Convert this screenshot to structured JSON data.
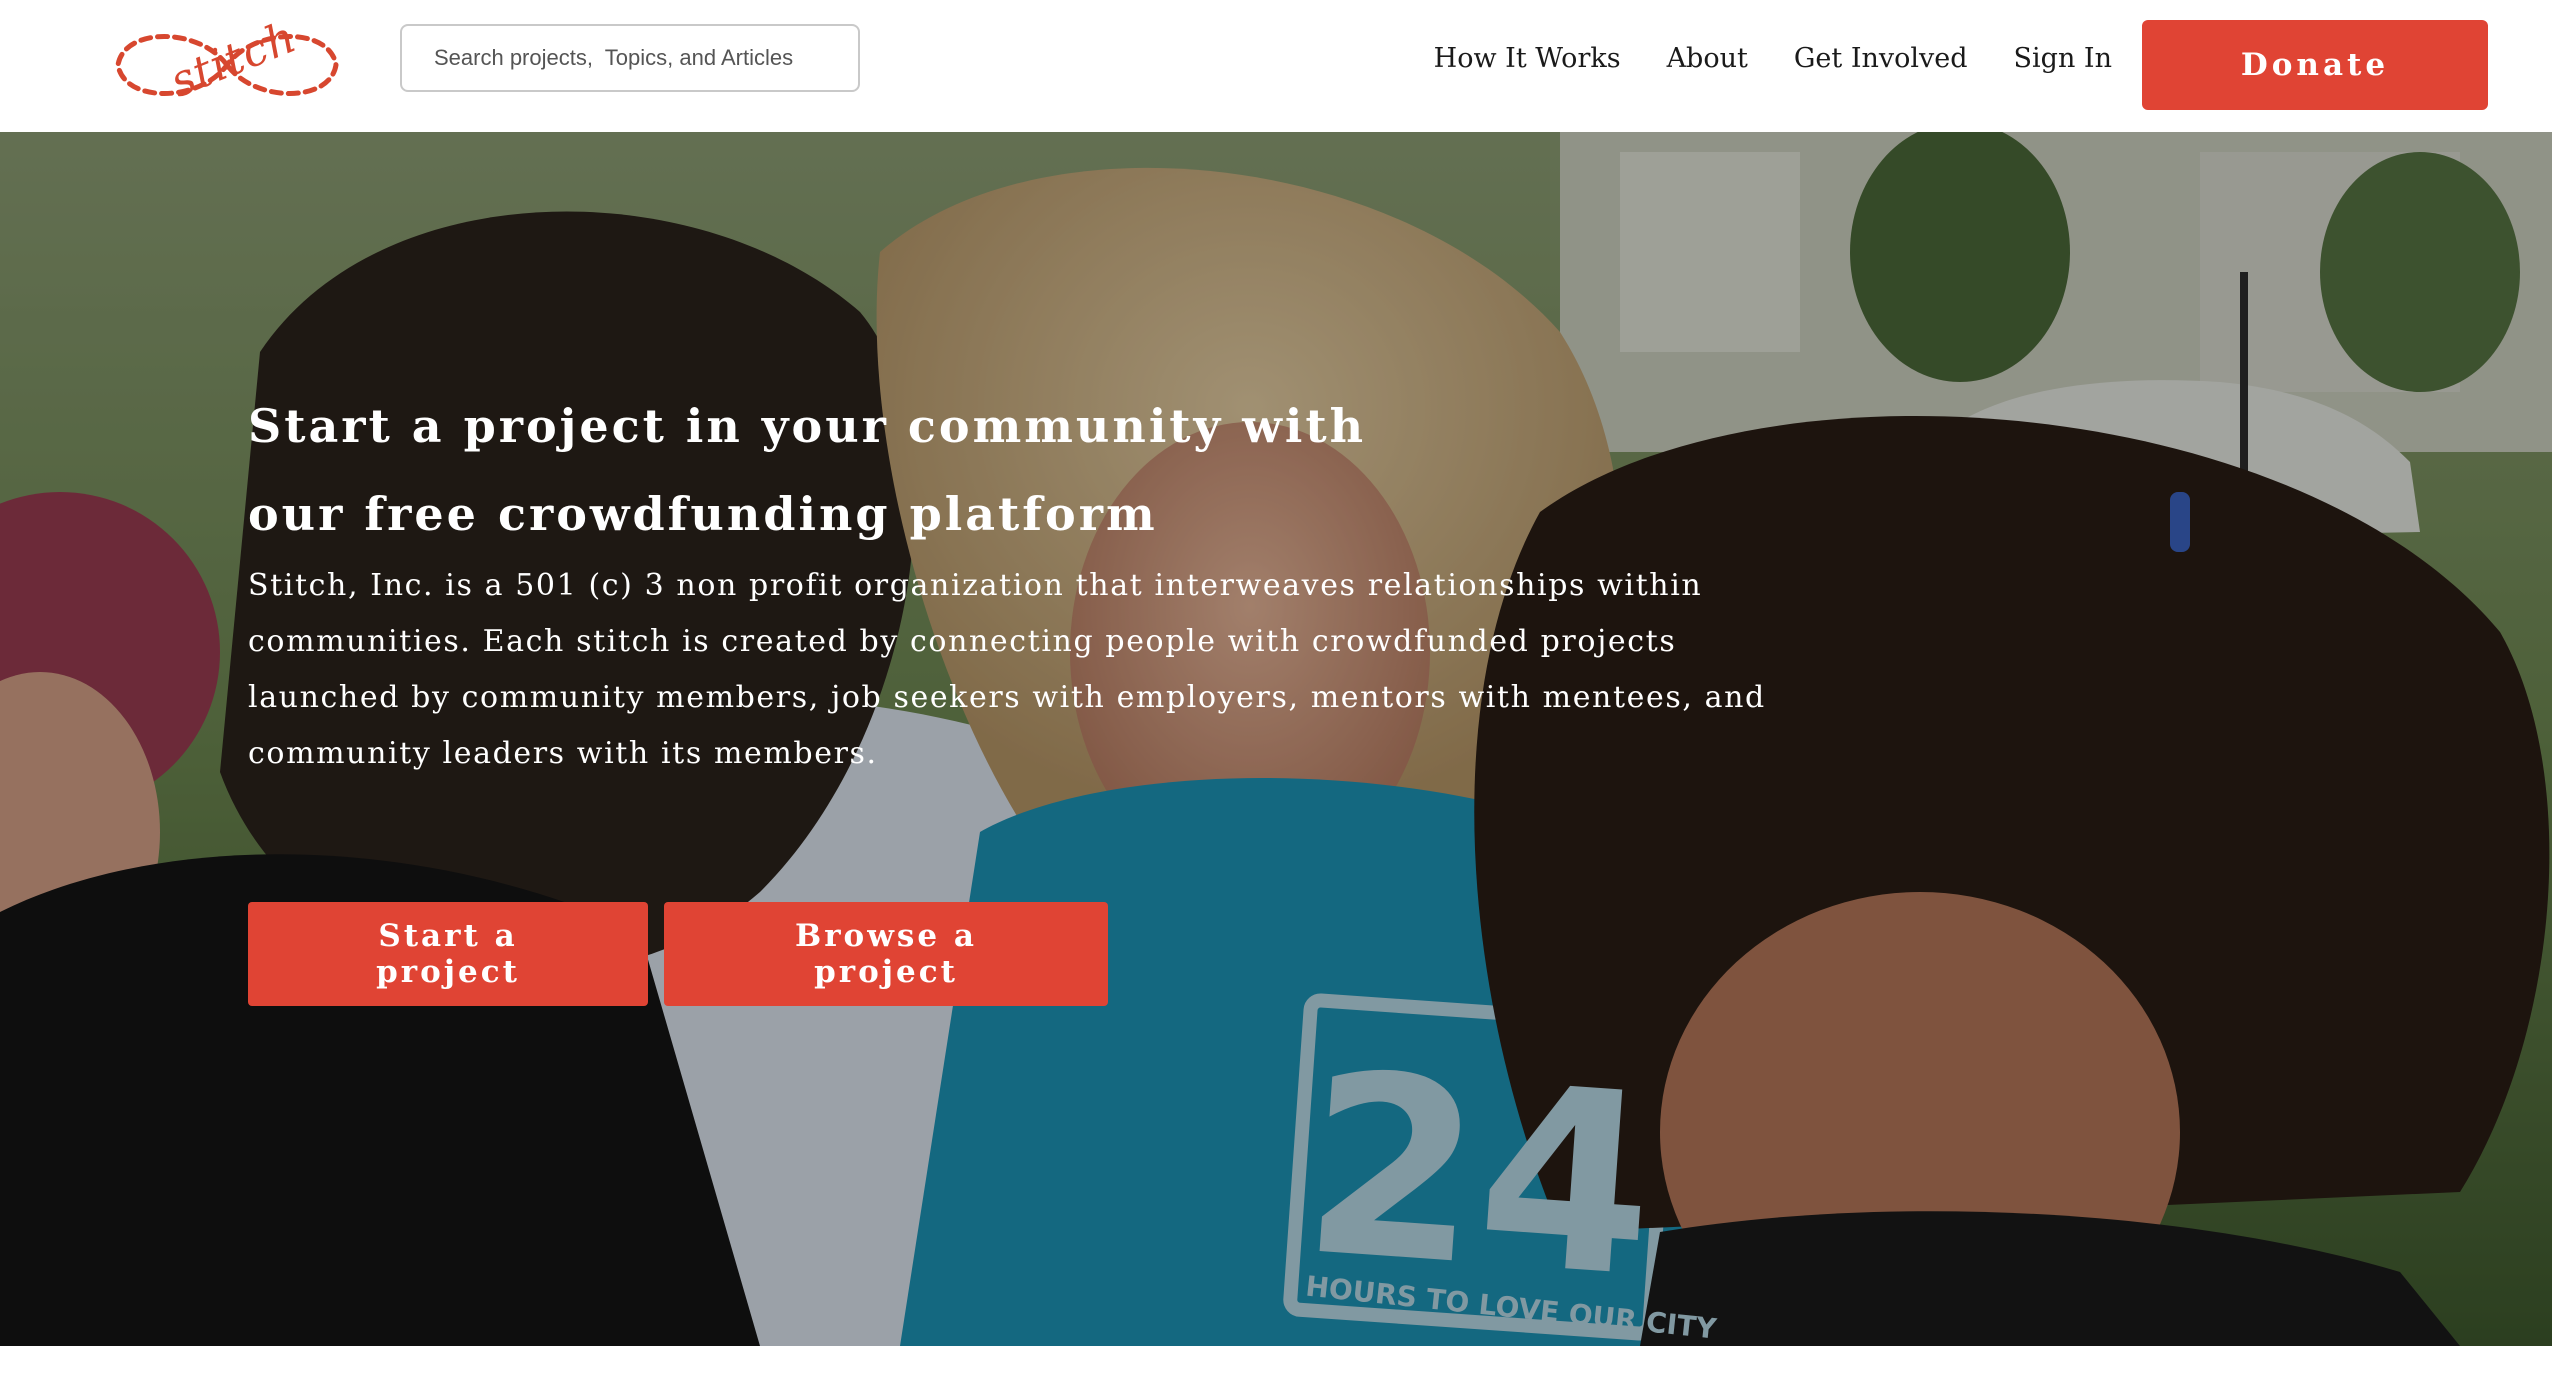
{
  "header": {
    "logo_text": "stitch",
    "search_placeholder": "Search projects,  Topics, and Articles",
    "nav": [
      "How It Works",
      "About",
      "Get Involved",
      "Sign In"
    ],
    "donate_label": "Donate"
  },
  "hero": {
    "title": "Start a project in your community with our free crowdfunding platform",
    "description": "Stitch, Inc. is a 501 (c) 3 non profit organization that interweaves relationships within communities. Each stitch is created by connecting people with crowdfunded projects launched by community members, job seekers with employers, mentors with mentees, and community leaders with its members.",
    "start_label": "Start a project",
    "browse_label": "Browse a project",
    "shirt_number": "24",
    "shirt_slogan": "HOURS TO LOVE OUR CITY"
  },
  "colors": {
    "accent": "#e04434",
    "header_bg": "#ffffff",
    "hero_text": "#ffffff"
  }
}
